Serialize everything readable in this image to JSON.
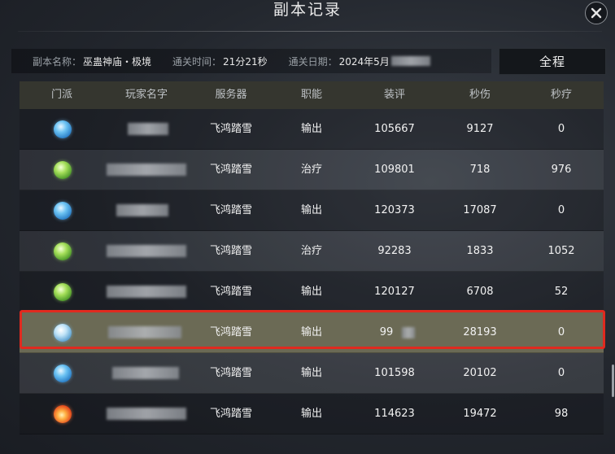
{
  "title": "副本记录",
  "info": {
    "dungeon_key": "副本名称：",
    "dungeon_val": "巫蛊神庙・极境",
    "time_key": "通关时间：",
    "time_val": "21分21秒",
    "date_key": "通关日期：",
    "date_val": "2024年5月"
  },
  "full_button": "全程",
  "columns": [
    "门派",
    "玩家名字",
    "服务器",
    "职能",
    "装评",
    "秒伤",
    "秒疗"
  ],
  "rows": [
    {
      "sect_icon": "water-sect-icon",
      "server": "飞鸿踏雪",
      "role": "输出",
      "gear": "105667",
      "dps": "9127",
      "hps": "0"
    },
    {
      "sect_icon": "leaf-sect-icon",
      "server": "飞鸿踏雪",
      "role": "治疗",
      "gear": "109801",
      "dps": "718",
      "hps": "976"
    },
    {
      "sect_icon": "water-sect-icon",
      "server": "飞鸿踏雪",
      "role": "输出",
      "gear": "120373",
      "dps": "17087",
      "hps": "0"
    },
    {
      "sect_icon": "leaf-sect-icon",
      "server": "飞鸿踏雪",
      "role": "治疗",
      "gear": "92283",
      "dps": "1833",
      "hps": "1052"
    },
    {
      "sect_icon": "leaf-sect-icon",
      "server": "飞鸿踏雪",
      "role": "输出",
      "gear": "120127",
      "dps": "6708",
      "hps": "52"
    },
    {
      "sect_icon": "snow-sect-icon",
      "server": "飞鸿踏雪",
      "role": "输出",
      "gear": "99",
      "dps": "28193",
      "hps": "0"
    },
    {
      "sect_icon": "water-sect-icon",
      "server": "飞鸿踏雪",
      "role": "输出",
      "gear": "101598",
      "dps": "20102",
      "hps": "0"
    },
    {
      "sect_icon": "fire-sect-icon",
      "server": "飞鸿踏雪",
      "role": "输出",
      "gear": "114623",
      "dps": "19472",
      "hps": "98"
    }
  ],
  "colors": {
    "highlight_border": "#e02a1f",
    "highlight_row": "#6b6a55"
  }
}
